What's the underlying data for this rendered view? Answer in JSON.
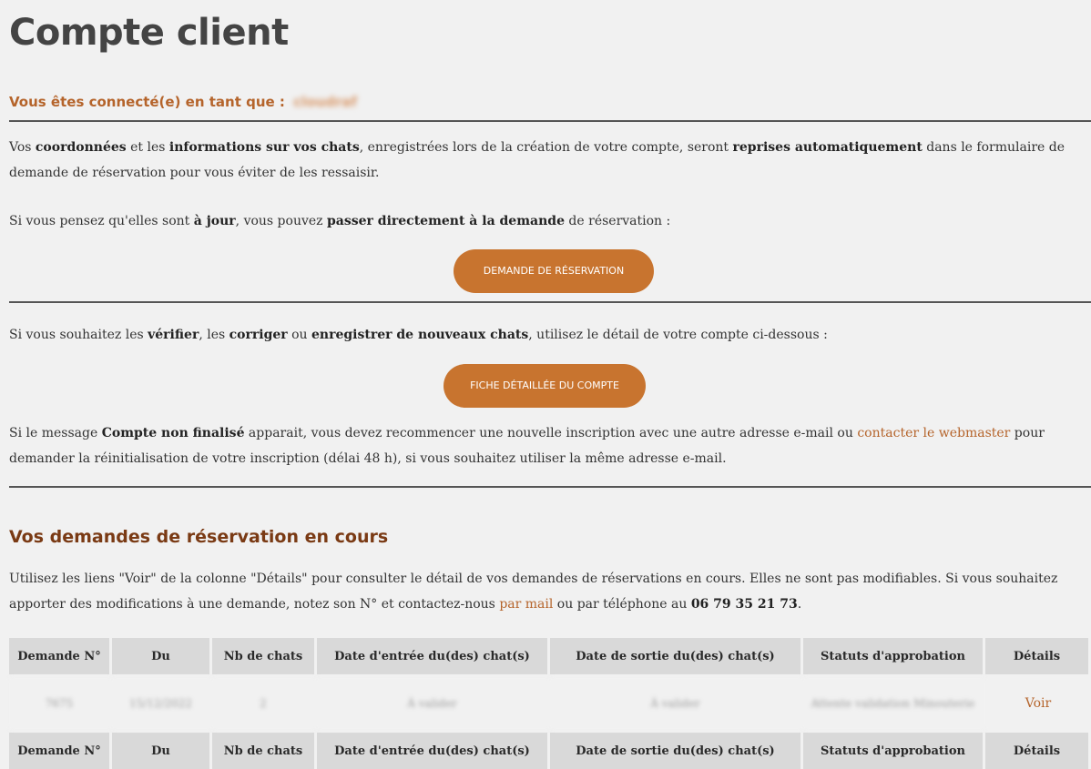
{
  "page": {
    "title": "Compte client"
  },
  "login": {
    "prefix": "Vous êtes connecté(e) en tant que :",
    "username": "cloudraf"
  },
  "intro": {
    "p1": [
      {
        "t": "Vos ",
        "b": false
      },
      {
        "t": "coordonnées",
        "b": true
      },
      {
        "t": " et les ",
        "b": false
      },
      {
        "t": "informations sur vos chats",
        "b": true
      },
      {
        "t": ", enregistrées lors de la création de votre compte, seront ",
        "b": false
      },
      {
        "t": "reprises automatiquement",
        "b": true
      },
      {
        "t": " dans le formulaire de demande de réservation pour vous éviter de les ressaisir.",
        "b": false
      }
    ],
    "p2": [
      {
        "t": "Si vous pensez qu'elles sont ",
        "b": false
      },
      {
        "t": "à jour",
        "b": true
      },
      {
        "t": ", vous pouvez ",
        "b": false
      },
      {
        "t": "passer directement à la demande",
        "b": true
      },
      {
        "t": " de réservation :",
        "b": false
      }
    ],
    "button": "DEMANDE DE RÉSERVATION"
  },
  "verify": {
    "p1": [
      {
        "t": "Si vous souhaitez les ",
        "b": false
      },
      {
        "t": "vérifier",
        "b": true
      },
      {
        "t": ", les ",
        "b": false
      },
      {
        "t": "corriger",
        "b": true
      },
      {
        "t": " ou ",
        "b": false
      },
      {
        "t": "enregistrer de nouveaux chats",
        "b": true
      },
      {
        "t": ", utilisez le détail de votre compte ci-dessous :",
        "b": false
      }
    ],
    "button": "FICHE DÉTAILLÉE DU COMPTE",
    "p2": [
      {
        "t": "Si le message ",
        "b": false
      },
      {
        "t": "Compte non finalisé",
        "b": true
      },
      {
        "t": " apparait, vous devez recommencer une nouvelle inscription avec une autre adresse e-mail ou ",
        "b": false
      },
      {
        "t": "contacter le webmaster",
        "link": true
      },
      {
        "t": " pour demander la réinitialisation de votre inscription (délai 48 h), si vous souhaitez utiliser la même adresse e-mail.",
        "b": false
      }
    ]
  },
  "reservations": {
    "title": "Vos demandes de réservation en cours",
    "info": [
      {
        "t": "Utilisez les liens \"Voir\" de la colonne \"Détails\" pour consulter le détail de vos demandes de réservations en cours. Elles ne sont pas modifiables. Si vous souhaitez apporter des modifications à une demande, notez son N° et contactez-nous ",
        "b": false
      },
      {
        "t": "par mail",
        "link": true
      },
      {
        "t": " ou par téléphone au ",
        "b": false
      },
      {
        "t": "06 79 35 21 73",
        "b": true
      },
      {
        "t": ".",
        "b": false
      }
    ],
    "columns": [
      "Demande N°",
      "Du",
      "Nb de chats",
      "Date d'entrée du(des) chat(s)",
      "Date de sortie du(des) chat(s)",
      "Statuts d'approbation",
      "Détails"
    ],
    "rows": [
      {
        "numero": "7675",
        "du": "15/12/2022",
        "nb_chats": "2",
        "entree": "À valider",
        "sortie": "À valider",
        "statut": "Attente validation Minouterie",
        "details": "Voir"
      }
    ]
  },
  "colors": {
    "accent": "#c8742f",
    "link": "#b5642b",
    "section_title": "#7a3a14",
    "background": "#f1f1f1",
    "table_header": "#d9d9d9"
  }
}
